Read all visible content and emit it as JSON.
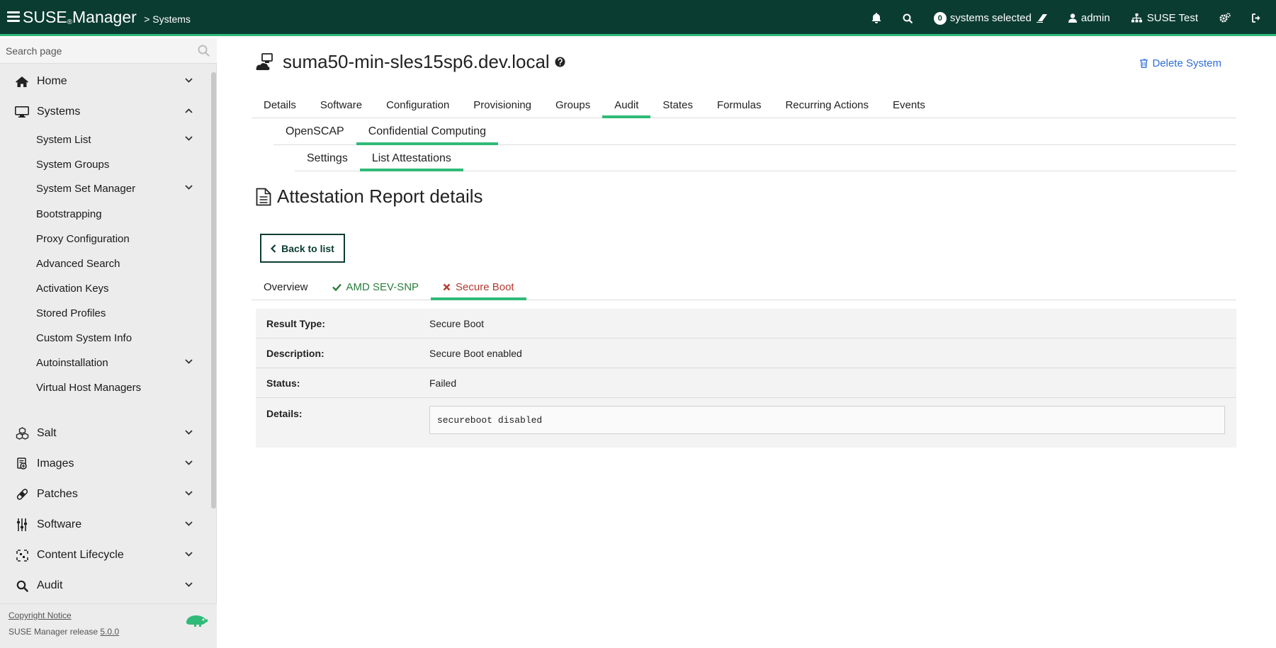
{
  "header": {
    "brand": "SUSE",
    "brand_reg": "®",
    "brand_product": "Manager",
    "breadcrumb": "> Systems",
    "systems_selected_count": "0",
    "systems_selected_label": "systems selected",
    "user": "admin",
    "organization": "SUSE Test"
  },
  "sidebar": {
    "search_placeholder": "Search page",
    "items": [
      {
        "label": "Home"
      },
      {
        "label": "Systems"
      },
      {
        "label": "System List"
      },
      {
        "label": "System Groups"
      },
      {
        "label": "System Set Manager"
      },
      {
        "label": "Bootstrapping"
      },
      {
        "label": "Proxy Configuration"
      },
      {
        "label": "Advanced Search"
      },
      {
        "label": "Activation Keys"
      },
      {
        "label": "Stored Profiles"
      },
      {
        "label": "Custom System Info"
      },
      {
        "label": "Autoinstallation"
      },
      {
        "label": "Virtual Host Managers"
      },
      {
        "label": "Salt"
      },
      {
        "label": "Images"
      },
      {
        "label": "Patches"
      },
      {
        "label": "Software"
      },
      {
        "label": "Content Lifecycle"
      },
      {
        "label": "Audit"
      }
    ],
    "footer": {
      "copyright": "Copyright Notice",
      "release_prefix": "SUSE Manager release",
      "release_version": "5.0.0"
    }
  },
  "main": {
    "system_name": "suma50-min-sles15sp6.dev.local",
    "delete_label": "Delete System",
    "tabs_level1": [
      "Details",
      "Software",
      "Configuration",
      "Provisioning",
      "Groups",
      "Audit",
      "States",
      "Formulas",
      "Recurring Actions",
      "Events"
    ],
    "tabs_level2": [
      "OpenSCAP",
      "Confidential Computing"
    ],
    "tabs_level3": [
      "Settings",
      "List Attestations"
    ],
    "page_title": "Attestation Report details",
    "back_label": "Back to list",
    "report_tabs": [
      "Overview",
      "AMD SEV-SNP",
      "Secure Boot"
    ],
    "details": {
      "result_type_label": "Result Type:",
      "result_type": "Secure Boot",
      "description_label": "Description:",
      "description": "Secure Boot enabled",
      "status_label": "Status:",
      "status": "Failed",
      "details_label": "Details:",
      "details_text": "secureboot disabled"
    }
  },
  "colors": {
    "header_bg": "#0b3c32",
    "accent_green": "#30ba78",
    "link_blue": "#2f6ed3",
    "success_green": "#2a7d3c",
    "fail_red": "#b23a30"
  }
}
